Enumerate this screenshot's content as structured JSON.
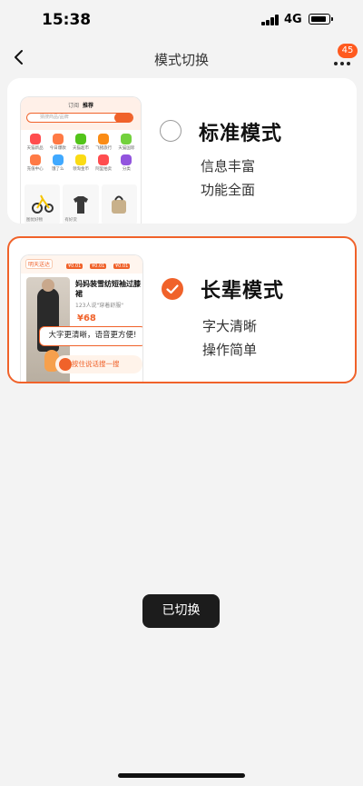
{
  "status_bar": {
    "time": "15:38",
    "network": "4G"
  },
  "nav": {
    "title": "模式切换",
    "badge_count": "45"
  },
  "modes": {
    "standard": {
      "title": "标准模式",
      "desc_line1": "信息丰富",
      "desc_line2": "功能全面",
      "selected": false,
      "preview": {
        "tab_1": "订阅",
        "tab_2": "推荐",
        "search_placeholder": "猜搜商品/品牌",
        "icon_labels": [
          "天猫新品",
          "今日爆款",
          "天猫超市",
          "飞猪旅行",
          "天猫国际",
          "充值中心",
          "饿了么",
          "领淘金币",
          "阿里拍卖",
          "分类"
        ],
        "product_captions": [
          "图优好物",
          "有好货",
          ""
        ]
      }
    },
    "elder": {
      "title": "长辈模式",
      "desc_line1": "字大清晰",
      "desc_line2": "操作简单",
      "selected": true,
      "preview": {
        "top_tag": "明天送达",
        "prices": [
          "¥0.01",
          "¥0.01",
          "¥0.01"
        ],
        "product_title": "妈妈装雪纺短袖过膝裙",
        "product_sub": "123人说\"穿着舒服\"",
        "product_price": "¥68",
        "bubble_text": "大字更清晰，语音更方便!",
        "voice_button": "按住说话搜一搜"
      }
    }
  },
  "toast": {
    "text": "已切换"
  },
  "colors": {
    "accent": "#f0622a",
    "badge": "#ff5a1f"
  }
}
